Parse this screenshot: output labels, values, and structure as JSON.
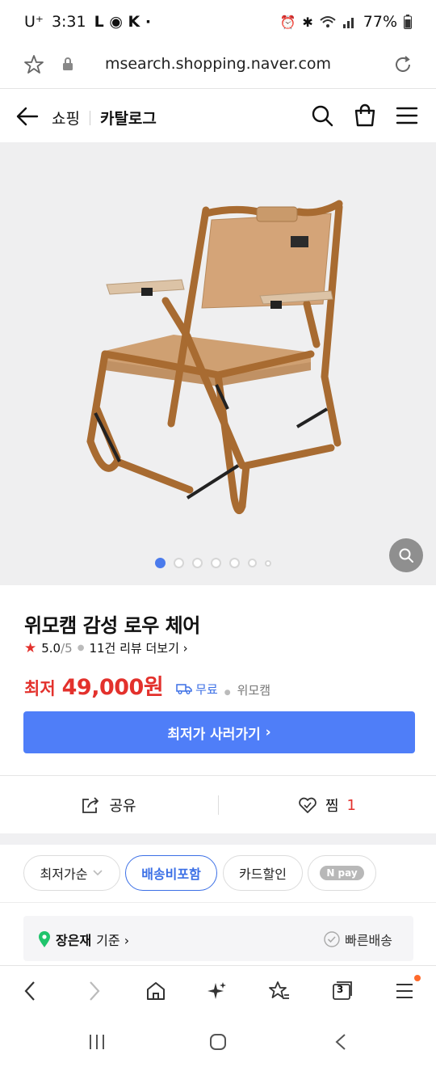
{
  "status_bar": {
    "carrier": "U⁺",
    "time": "3:31",
    "battery": "77%"
  },
  "browser": {
    "url": "msearch.shopping.naver.com"
  },
  "header": {
    "shopping_label": "쇼핑",
    "catalog_label": "카탈로그"
  },
  "gallery": {
    "total_images": 7,
    "current_index": 1
  },
  "product": {
    "title": "위모캠 감성 로우 체어",
    "rating": "5.0",
    "rating_total": "/5",
    "review_link": "11건 리뷰 더보기",
    "price_label": "최저",
    "price": "49,000원",
    "shipping": "무료",
    "mall": "위모캠",
    "buy_button": "최저가 사러가기"
  },
  "actions": {
    "share_label": "공유",
    "wish_label": "찜",
    "wish_count": "1"
  },
  "filters": [
    {
      "label": "최저가순",
      "active": false
    },
    {
      "label": "배송비포함",
      "active": true
    },
    {
      "label": "카드할인",
      "active": false
    }
  ],
  "npay_label": "N pay",
  "location": {
    "name": "장은재",
    "suffix": "기준",
    "fast_delivery": "빠른배송"
  },
  "bottom_nav": {
    "tabs_count": "3"
  },
  "colors": {
    "accent": "#4f7ef8",
    "price_red": "#e3312c",
    "link_blue": "#3b6fe6",
    "chair_canvas": "#d1a377",
    "chair_frame": "#a86b31"
  }
}
